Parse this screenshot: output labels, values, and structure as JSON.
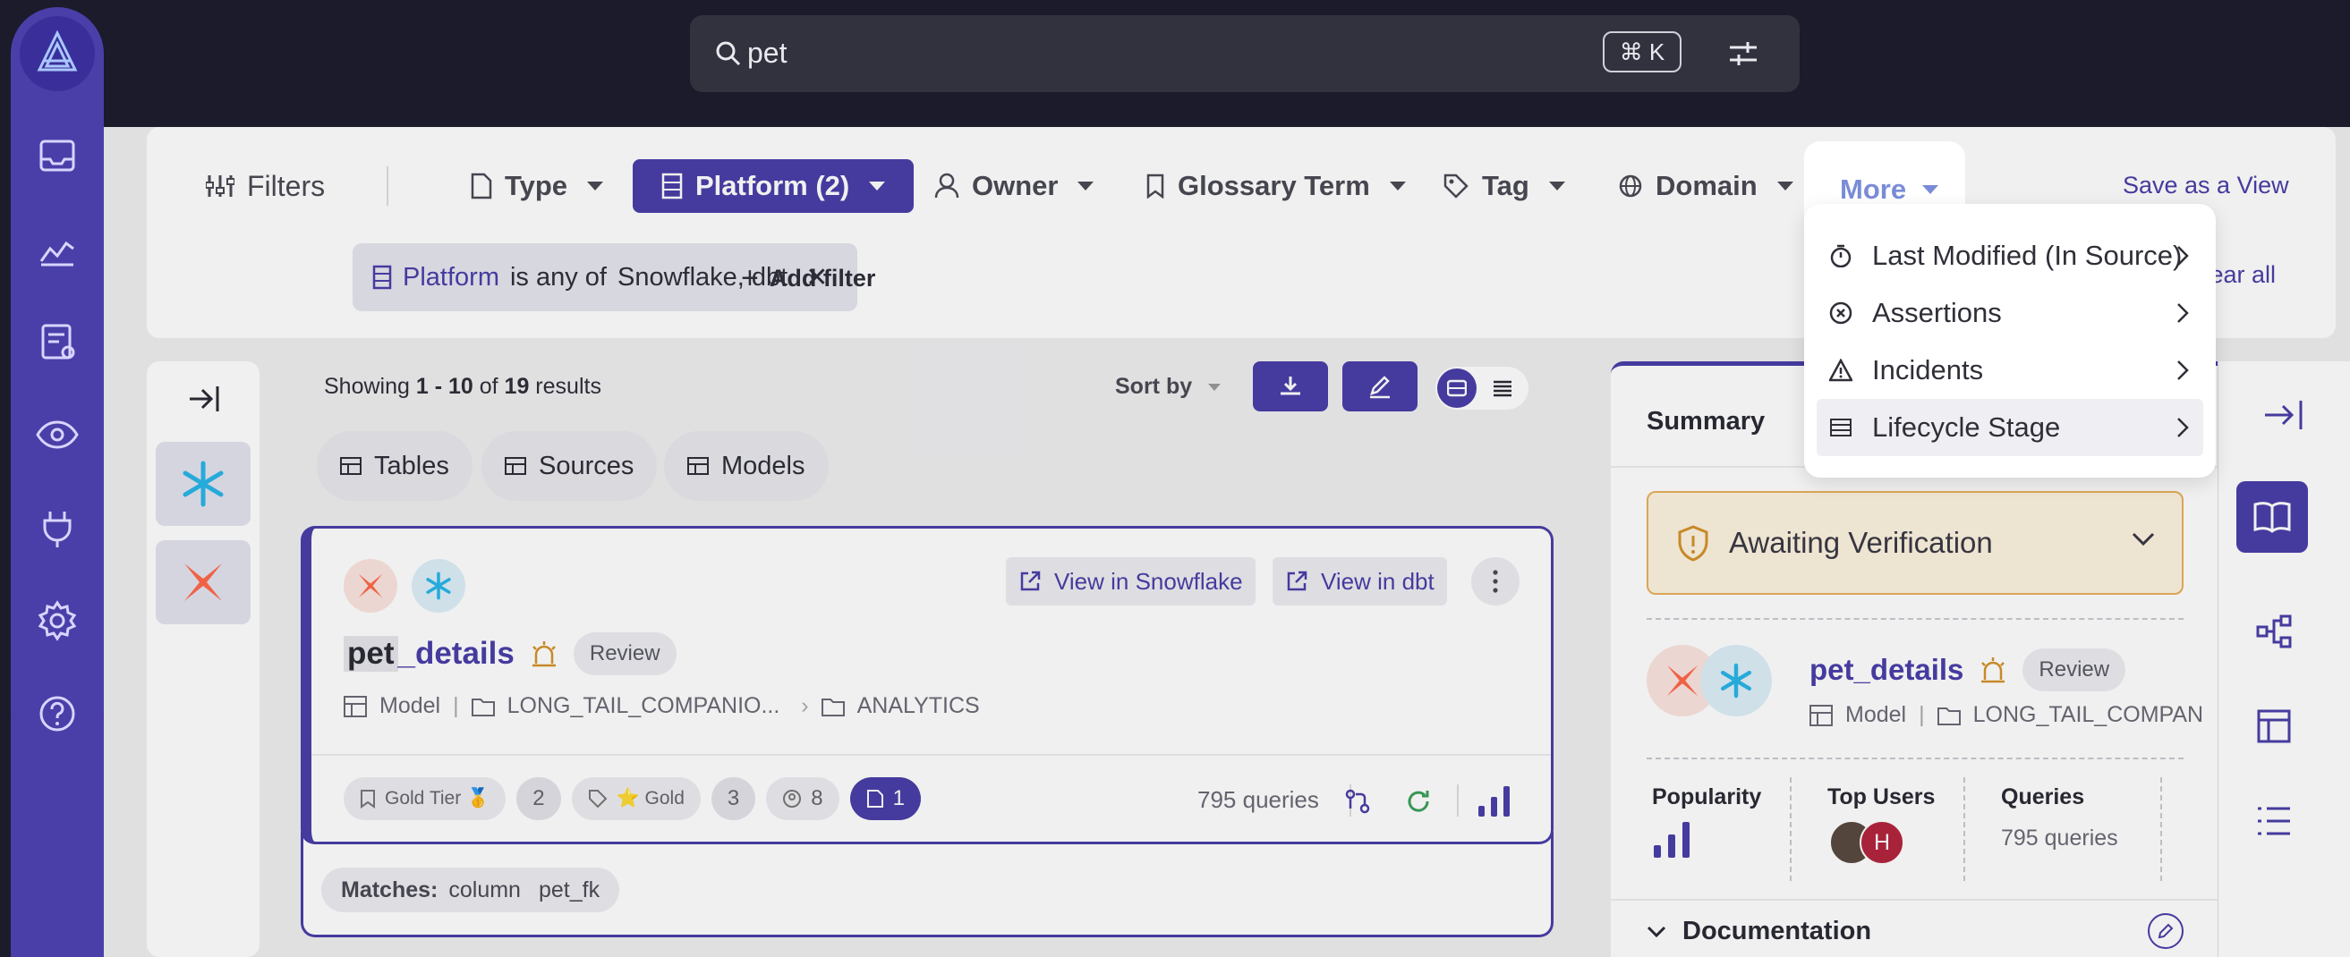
{
  "search": {
    "value": "pet",
    "shortcut": "⌘ K"
  },
  "filters": {
    "label": "Filters",
    "items": [
      {
        "label": "Type"
      },
      {
        "label": "Platform (2)"
      },
      {
        "label": "Owner"
      },
      {
        "label": "Glossary Term"
      },
      {
        "label": "Tag"
      },
      {
        "label": "Domain"
      },
      {
        "label": "More"
      }
    ],
    "save_view": "Save as a View",
    "clear_all": "Clear all",
    "active": {
      "field": "Platform",
      "op": "is any of",
      "values": "Snowflake, dbt"
    },
    "add_filter": "Add filter"
  },
  "more_menu": {
    "items": [
      {
        "label": "Last Modified (In Source)"
      },
      {
        "label": "Assertions"
      },
      {
        "label": "Incidents"
      },
      {
        "label": "Lifecycle Stage"
      }
    ]
  },
  "results": {
    "showing_prefix": "Showing ",
    "range": "1 - 10",
    "of": " of ",
    "total": "19",
    "suffix": " results",
    "sort_by": "Sort by",
    "tabs": [
      "Tables",
      "Sources",
      "Models"
    ]
  },
  "card": {
    "name_highlight": "pet",
    "name_rest": "_details",
    "badge": "Review",
    "view_snowflake": "View in Snowflake",
    "view_dbt": "View in dbt",
    "type": "Model",
    "path1": "LONG_TAIL_COMPANIO...",
    "path2": "ANALYTICS",
    "gold_tier": "Gold Tier 🥇",
    "gold_tier_count": "2",
    "gold_tag": "⭐ Gold",
    "gold_tag_count": "3",
    "users_count": "8",
    "docs_count": "1",
    "queries": "795 queries",
    "matches_label": "Matches:",
    "matches_field": "column",
    "matches_value": "pet_fk"
  },
  "summary": {
    "title": "Summary",
    "verification": "Awaiting Verification",
    "name": "pet_details",
    "badge": "Review",
    "type": "Model",
    "path": "LONG_TAIL_COMPAN",
    "popularity_label": "Popularity",
    "top_users_label": "Top Users",
    "top_user_initial": "H",
    "queries_label": "Queries",
    "queries_value": "795 queries",
    "documentation": "Documentation"
  },
  "colors": {
    "accent": "#4a3fa8",
    "dark": "#1b1b2b",
    "warning": "#d4922a"
  }
}
